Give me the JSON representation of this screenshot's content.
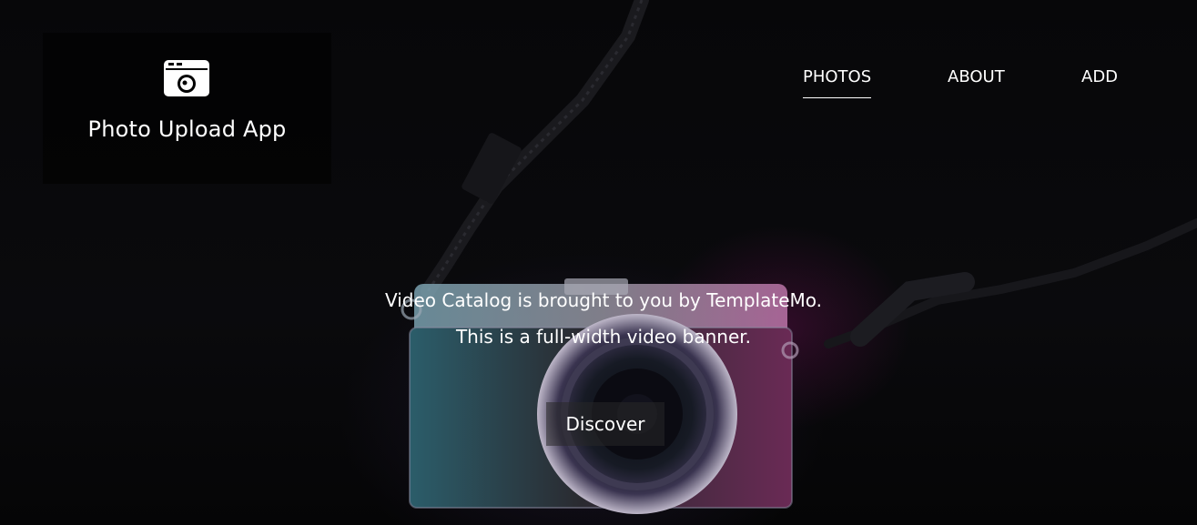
{
  "brand": {
    "name": "Photo Upload App",
    "logo_icon": "camera-icon"
  },
  "nav": {
    "items": [
      {
        "label": "PHOTOS",
        "active": true
      },
      {
        "label": "ABOUT",
        "active": false
      },
      {
        "label": "ADD",
        "active": false
      }
    ]
  },
  "hero": {
    "caption_line1": "Video Catalog is brought to you by TemplateMo.",
    "caption_line2": "This is a full-width video banner.",
    "button_label": "Discover"
  },
  "colors": {
    "background": "#050507",
    "text": "#ffffff",
    "accent_magenta": "#c21a8e",
    "accent_cyan": "#3fa6c8"
  }
}
